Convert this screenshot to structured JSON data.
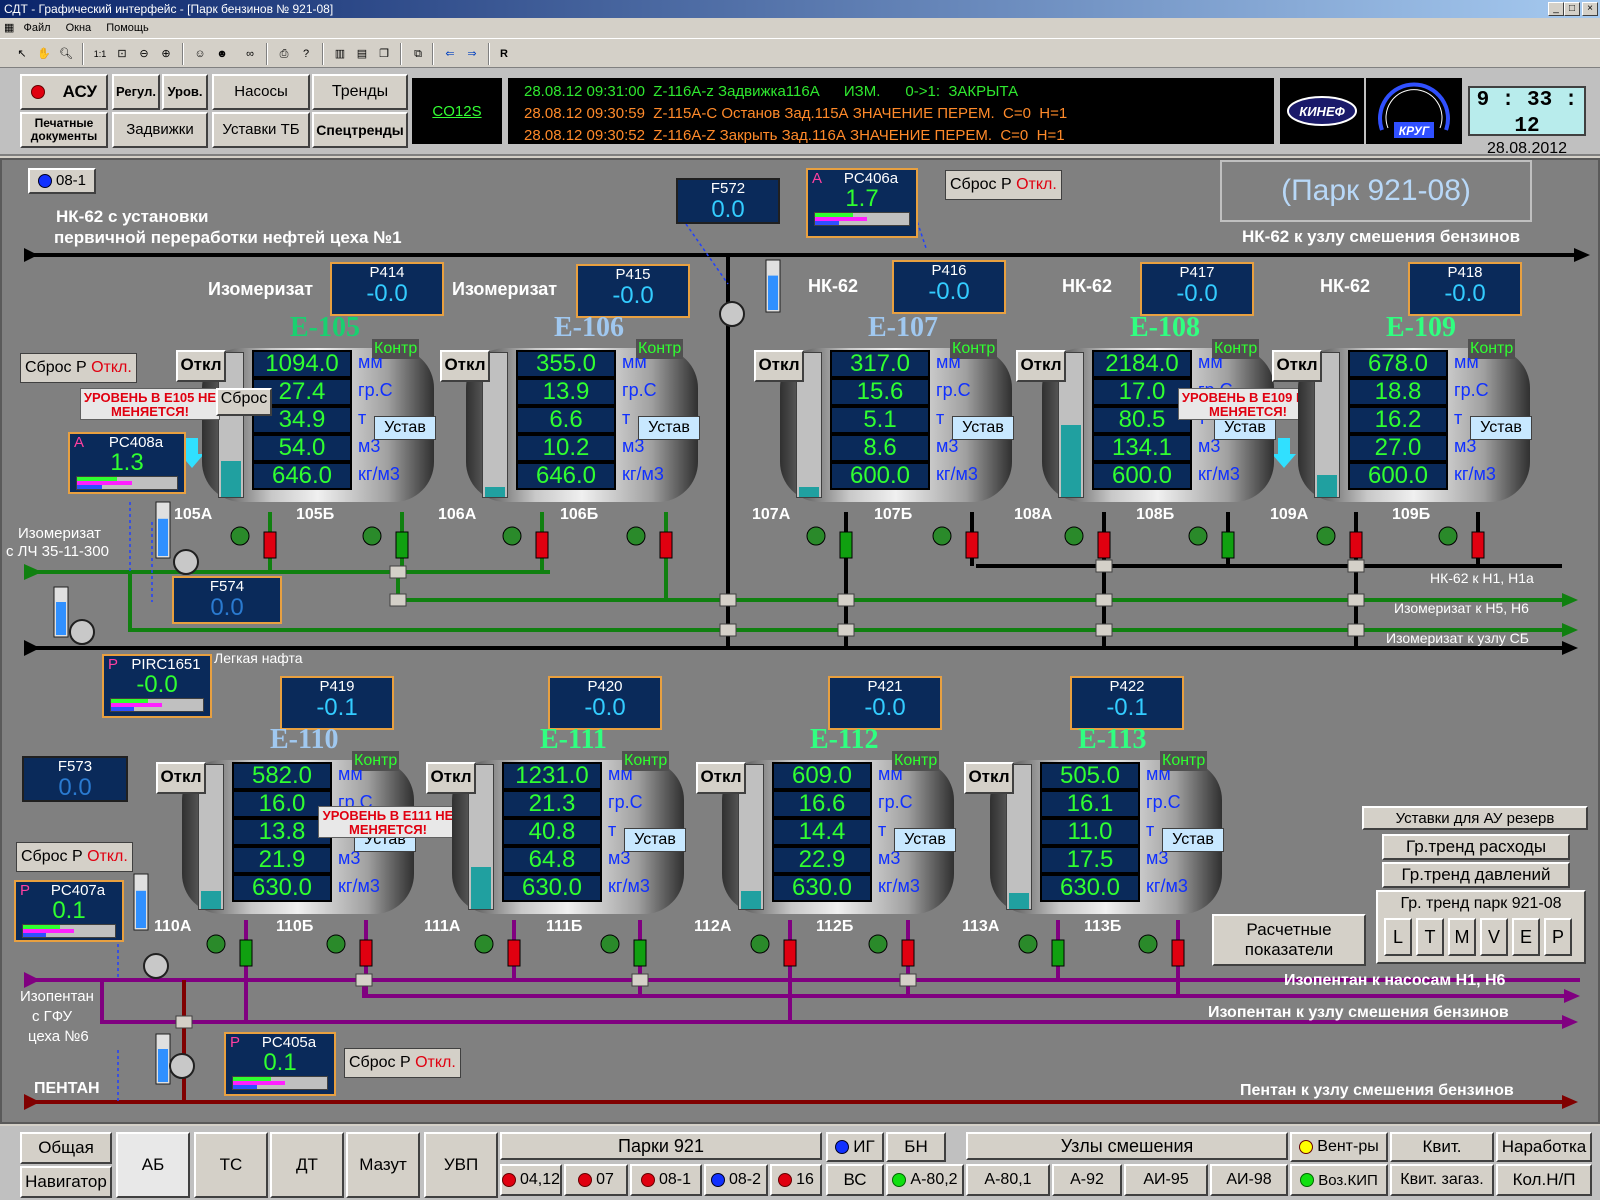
{
  "window": {
    "title": "СДТ - Графический интерфейс - [Парк бензинов № 921-08]"
  },
  "menu": [
    "Файл",
    "Окна",
    "Помощь"
  ],
  "header": {
    "buttons": {
      "asu": "АСУ",
      "regul": "Регул.",
      "urov": "Уров.",
      "nasosy": "Насосы",
      "trendy": "Тренды",
      "print": "Печатные документы",
      "zadv": "Задвижки",
      "ustavki": "Уставки ТБ",
      "spectrendy": "Спецтренды"
    },
    "link": "CO12S",
    "events": [
      "28.08.12 09:31:00  Z-116A-z Задвижка116A      ИЗМ.      0->1:  ЗАКРЫТА",
      "28.08.12 09:30:59  Z-115A-C Останов Зад.115А ЗНАЧЕНИЕ ПЕРЕМ.  C=0  H=1",
      "28.08.12 09:30:52  Z-116A-Z Закрыть Зад.116А ЗНАЧЕНИЕ ПЕРЕМ.  C=0  H=1"
    ],
    "logo1": "КИНЕФ",
    "logo2": "КРУГ",
    "clock": {
      "time": "9 : 33 : 12",
      "date": "28.08.2012"
    }
  },
  "scheme": {
    "tag": "08-1",
    "title": "(Парк 921-08)",
    "line_labels": {
      "nk62_src": "НК-62 с установки",
      "nk62_src2": "первичной переработки нефтей цеха №1",
      "nk62_dst": "НК-62 к узлу смешения бензинов",
      "iso_src": "Изомеризат",
      "iso_src2": "с ЛЧ 35-11-300",
      "nk62_h1": "НК-62 к Н1, Н1а",
      "iso_h5": "Изомеризат к Н5, Н6",
      "iso_sb": "Изомеризат к узлу СБ",
      "naphtha": "Легкая нафта",
      "isop_src": "Изопентан",
      "isop_src2": "с ГФУ",
      "isop_src3": "цеха №6",
      "isop_h1": "Изопентан к насосам Н1, Н6",
      "isop_mix": "Изопентан к узлу смешения бензинов",
      "pentan": "ПЕНТАН",
      "pentan_mix": "Пентан к узлу смешения бензинов"
    },
    "product_labels": [
      "Изомеризат",
      "Изомеризат",
      "НК-62",
      "НК-62",
      "НК-62"
    ],
    "flows": {
      "F572": {
        "name": "F572",
        "value": "0.0"
      },
      "F574": {
        "name": "F574",
        "value": "0.0"
      },
      "F573": {
        "name": "F573",
        "value": "0.0"
      }
    },
    "pc": {
      "PC406a": {
        "mode": "A",
        "name": "PC406a",
        "value": "1.7"
      },
      "PC408a": {
        "mode": "A",
        "name": "PC408a",
        "value": "1.3"
      },
      "PIRC1651": {
        "mode": "P",
        "name": "PIRC1651",
        "value": "-0.0"
      },
      "PC407a": {
        "mode": "P",
        "name": "PC407a",
        "value": "0.1"
      },
      "PC405a": {
        "mode": "P",
        "name": "PC405a",
        "value": "0.1"
      }
    },
    "reset": {
      "label": "Сброс Р",
      "state": "Откл."
    },
    "pressures": [
      {
        "name": "P414",
        "value": "-0.0"
      },
      {
        "name": "P415",
        "value": "-0.0"
      },
      {
        "name": "P416",
        "value": "-0.0"
      },
      {
        "name": "P417",
        "value": "-0.0"
      },
      {
        "name": "P418",
        "value": "-0.0"
      },
      {
        "name": "P419",
        "value": "-0.1"
      },
      {
        "name": "P420",
        "value": "-0.0"
      },
      {
        "name": "P421",
        "value": "-0.0"
      },
      {
        "name": "P422",
        "value": "-0.1"
      }
    ],
    "tank_common": {
      "otkl": "Откл",
      "kontr": "Контр",
      "ustav": "Устав",
      "sbros": "Сброс",
      "units": [
        "мм",
        "гр.С",
        "т",
        "м3",
        "кг/м3"
      ]
    },
    "tanks": [
      {
        "name": "Е-105",
        "values": [
          "1094.0",
          "27.4",
          "34.9",
          "54.0",
          "646.0"
        ],
        "valves": [
          "105А",
          "105Б"
        ],
        "level": 0.3,
        "alert": "УРОВЕНЬ В  Е105 НЕ МЕНЯЕТСЯ!"
      },
      {
        "name": "Е-106",
        "values": [
          "355.0",
          "13.9",
          "6.6",
          "10.2",
          "646.0"
        ],
        "valves": [
          "106А",
          "106Б"
        ],
        "level": 0.08
      },
      {
        "name": "Е-107",
        "values": [
          "317.0",
          "15.6",
          "5.1",
          "8.6",
          "600.0"
        ],
        "valves": [
          "107А",
          "107Б"
        ],
        "level": 0.08
      },
      {
        "name": "Е-108",
        "values": [
          "2184.0",
          "17.0",
          "80.5",
          "134.1",
          "600.0"
        ],
        "valves": [
          "108А",
          "108Б"
        ],
        "level": 0.6,
        "alert": "УРОВЕНЬ В  Е109 НЕ МЕНЯЕТСЯ!"
      },
      {
        "name": "Е-109",
        "values": [
          "678.0",
          "18.8",
          "16.2",
          "27.0",
          "600.0"
        ],
        "valves": [
          "109А",
          "109Б"
        ],
        "level": 0.18
      },
      {
        "name": "Е-110",
        "values": [
          "582.0",
          "16.0",
          "13.8",
          "21.9",
          "630.0"
        ],
        "valves": [
          "110А",
          "110Б"
        ],
        "level": 0.15,
        "alert": "УРОВЕНЬ В  Е111 НЕ МЕНЯЕТСЯ!"
      },
      {
        "name": "Е-111",
        "values": [
          "1231.0",
          "21.3",
          "40.8",
          "64.8",
          "630.0"
        ],
        "valves": [
          "111А",
          "111Б"
        ],
        "level": 0.35
      },
      {
        "name": "Е-112",
        "values": [
          "609.0",
          "16.6",
          "14.4",
          "22.9",
          "630.0"
        ],
        "valves": [
          "112А",
          "112Б"
        ],
        "level": 0.15
      },
      {
        "name": "Е-113",
        "values": [
          "505.0",
          "16.1",
          "11.0",
          "17.5",
          "630.0"
        ],
        "valves": [
          "113А",
          "113Б"
        ],
        "level": 0.13
      }
    ],
    "right_panel": {
      "setpoints": "Уставки для АУ резерв",
      "trend_flow": "Гр.тренд расходы",
      "trend_press": "Гр.тренд давлений",
      "trend_park": "Гр. тренд  парк 921-08",
      "letters": [
        "L",
        "T",
        "M",
        "V",
        "E",
        "P"
      ],
      "calc": "Расчетные показатели"
    }
  },
  "nav": {
    "obshaya": "Общая",
    "navigator": "Навигатор",
    "ab": "АБ",
    "tc": "ТС",
    "dt": "ДТ",
    "mazut": "Мазут",
    "uvp": "УВП",
    "parki": "Парки 921",
    "park_items": [
      "04,12",
      "07",
      "08-1",
      "08-2",
      "16"
    ],
    "ig": "ИГ",
    "bn": "БН",
    "vc": "ВС",
    "a802": "А-80,2",
    "uzly": "Узлы смешения",
    "uzly_items": [
      "А-80,1",
      "А-92",
      "АИ-95",
      "АИ-98"
    ],
    "vent": "Вент-ры",
    "voz": "Воз.КИП",
    "kvit": "Квит.",
    "kvit_zagaz": "Квит. загаз.",
    "narabotka": "Наработка",
    "kolnp": "Кол.Н/П"
  },
  "colors": {
    "bg": "#808080",
    "pipe_black": "#000000",
    "pipe_green": "#108010",
    "pipe_purple": "#800080",
    "pipe_red": "#800000",
    "value": "#30ff30",
    "alarm": "#e00010"
  }
}
